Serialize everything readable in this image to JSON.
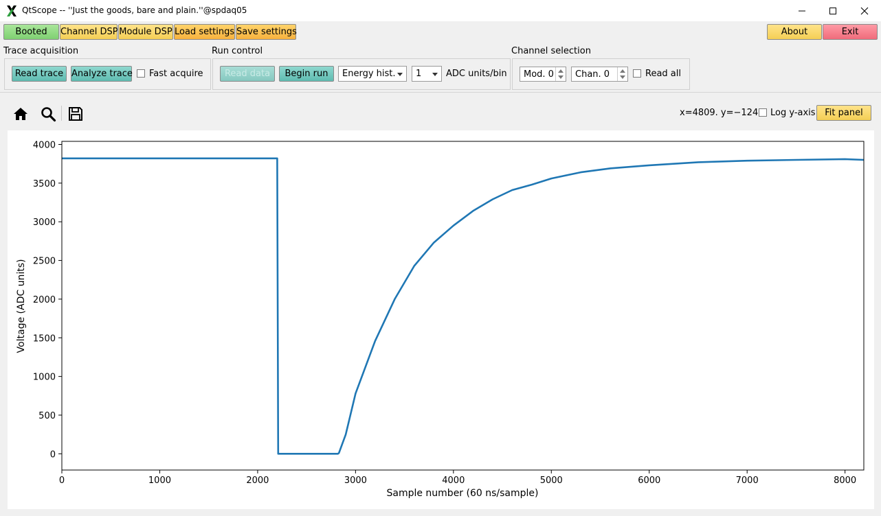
{
  "window": {
    "title": "QtScope -- ''Just the goods, bare and plain.''@spdaq05",
    "app_icon": "x-logo-icon",
    "controls": [
      "minimize-icon",
      "maximize-icon",
      "close-icon"
    ]
  },
  "toolbar": {
    "booted_label": "Booted",
    "channel_dsp_label": "Channel DSP",
    "module_dsp_label": "Module DSP",
    "load_settings_label": "Load settings",
    "save_settings_label": "Save settings",
    "about_label": "About",
    "exit_label": "Exit"
  },
  "trace_acquisition": {
    "title": "Trace acquisition",
    "read_trace_label": "Read trace",
    "analyze_trace_label": "Analyze trace",
    "fast_acquire_label": "Fast acquire",
    "fast_acquire_checked": false
  },
  "run_control": {
    "title": "Run control",
    "read_data_label": "Read data",
    "begin_run_label": "Begin run",
    "histogram_select": "Energy hist.",
    "bin_select": "1",
    "bin_units_label": "ADC units/bin"
  },
  "channel_selection": {
    "title": "Channel selection",
    "module_spin": "Mod. 0",
    "channel_spin": "Chan. 0",
    "read_all_label": "Read all",
    "read_all_checked": false
  },
  "plot_toolbar": {
    "icons": [
      "home-icon",
      "zoom-icon",
      "save-icon"
    ],
    "coordinates": "x=4809. y=−124.",
    "log_y_label": "Log y-axis",
    "log_y_checked": false,
    "fit_panel_label": "Fit panel"
  },
  "colors": {
    "trace": "#1f77b4",
    "booted": "#8fdc80",
    "exit": "#f47f8c",
    "teal_button": "#72c9be"
  },
  "chart_data": {
    "type": "line",
    "title": "",
    "xlabel": "Sample number (60 ns/sample)",
    "ylabel": "Voltage (ADC units)",
    "xlim": [
      0,
      8192
    ],
    "ylim": [
      -210,
      4040
    ],
    "xticks": [
      0,
      1000,
      2000,
      3000,
      4000,
      5000,
      6000,
      7000,
      8000
    ],
    "yticks": [
      0,
      500,
      1000,
      1500,
      2000,
      2500,
      3000,
      3500,
      4000
    ],
    "grid": false,
    "legend": "none",
    "series": [
      {
        "x": [
          0,
          2190,
          2200,
          2210,
          2820,
          2830,
          2900,
          3000,
          3200,
          3400,
          3600,
          3800,
          4000,
          4200,
          4400,
          4600,
          4800,
          5000,
          5300,
          5600,
          6000,
          6500,
          7000,
          7500,
          8000,
          8192
        ],
        "y": [
          3820,
          3820,
          3820,
          0,
          0,
          10,
          250,
          780,
          1460,
          2000,
          2430,
          2730,
          2950,
          3140,
          3290,
          3410,
          3480,
          3560,
          3640,
          3690,
          3730,
          3770,
          3790,
          3800,
          3810,
          3800
        ]
      }
    ]
  }
}
